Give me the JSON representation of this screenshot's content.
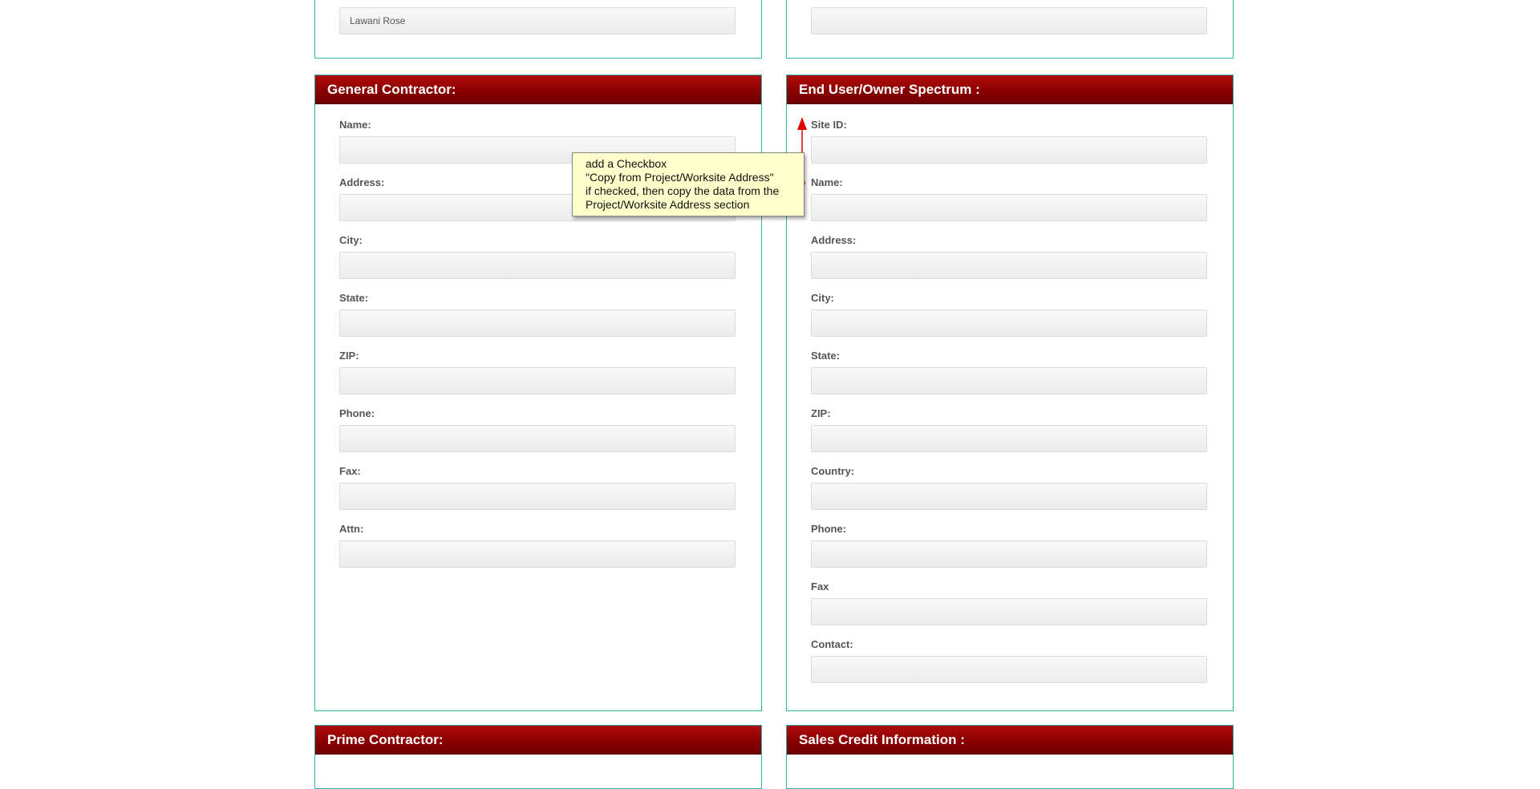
{
  "top_left_panel": {
    "name_value": "Lawani Rose"
  },
  "top_right_panel": {
    "value": ""
  },
  "general_contractor": {
    "title": "General Contractor:",
    "fields": [
      {
        "label": "Name:",
        "value": ""
      },
      {
        "label": "Address:",
        "value": ""
      },
      {
        "label": "City:",
        "value": ""
      },
      {
        "label": "State:",
        "value": ""
      },
      {
        "label": "ZIP:",
        "value": ""
      },
      {
        "label": "Phone:",
        "value": ""
      },
      {
        "label": "Fax:",
        "value": ""
      },
      {
        "label": "Attn:",
        "value": ""
      }
    ]
  },
  "end_user": {
    "title": "End User/Owner Spectrum :",
    "fields": [
      {
        "label": "Site ID:",
        "value": ""
      },
      {
        "label": "Name:",
        "value": ""
      },
      {
        "label": "Address:",
        "value": ""
      },
      {
        "label": "City:",
        "value": ""
      },
      {
        "label": "State:",
        "value": ""
      },
      {
        "label": "ZIP:",
        "value": ""
      },
      {
        "label": "Country:",
        "value": ""
      },
      {
        "label": "Phone:",
        "value": ""
      },
      {
        "label": "Fax",
        "value": ""
      },
      {
        "label": "Contact:",
        "value": ""
      }
    ]
  },
  "prime_contractor": {
    "title": "Prime Contractor:"
  },
  "sales_credit": {
    "title": "Sales Credit Information :"
  },
  "annotation": {
    "lines": [
      "add a Checkbox",
      "\"Copy from Project/Worksite Address\"",
      "if checked, then copy the data from the",
      "Project/Worksite Address section"
    ],
    "color": "#ffffcc",
    "pointer_color": "#e00000"
  },
  "colors": {
    "header_red": "#8a0000",
    "panel_border": "#2ab3a6",
    "label_gray": "#555555"
  }
}
